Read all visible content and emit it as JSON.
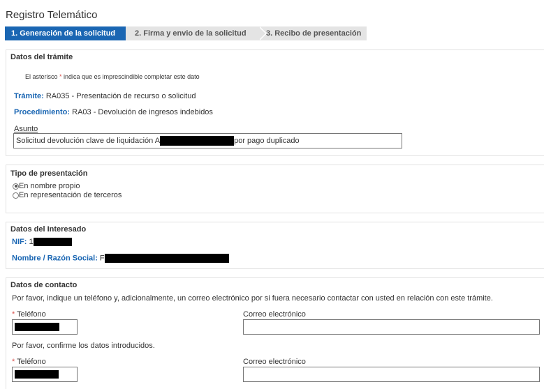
{
  "page": {
    "title": "Registro Telemático"
  },
  "steps": [
    {
      "label": "1. Generación de la solicitud",
      "active": true
    },
    {
      "label": "2. Firma y envio de la solicitud",
      "active": false
    },
    {
      "label": "3. Recibo de presentación",
      "active": false
    }
  ],
  "datos_tramite": {
    "title": "Datos del trámite",
    "note_prefix": "El asterisco ",
    "note_asterisk": "*",
    "note_suffix": " indica que es imprescindible completar este dato",
    "tramite_label": "Trámite:",
    "tramite_value": "RA035 - Presentación de recurso o solicitud",
    "procedimiento_label": "Procedimiento:",
    "procedimiento_value": "RA03 - Devolución de ingresos indebidos",
    "asunto_label": "Asunto",
    "asunto_value_start": "Solicitud devolución clave de liquidación A",
    "asunto_value_end": "por pago duplicado"
  },
  "tipo_presentacion": {
    "title": "Tipo de presentación",
    "options": [
      {
        "label": "En nombre propio",
        "checked": true
      },
      {
        "label": "En representación de terceros",
        "checked": false
      }
    ]
  },
  "datos_interesado": {
    "title": "Datos del Interesado",
    "nif_label": "NIF:",
    "nif_prefix": "1",
    "nombre_label": "Nombre / Razón Social:",
    "nombre_prefix": "F"
  },
  "datos_contacto": {
    "title": "Datos de contacto",
    "intro": "Por favor, indique un teléfono y, adicionalmente, un correo electrónico por si fuera necesario contactar con usted en relación con este trámite.",
    "telefono_label": "Teléfono",
    "correo_label": "Correo electrónico",
    "confirm_text": "Por favor, confirme los datos introducidos.",
    "telefono_confirm_label": "Teléfono",
    "correo_confirm_label": "Correo electrónico",
    "required_mark": "*"
  },
  "colors": {
    "primary": "#1a66b3",
    "step_inactive": "#e4e4e4",
    "required": "#d9534f",
    "redaction": "#000000"
  }
}
